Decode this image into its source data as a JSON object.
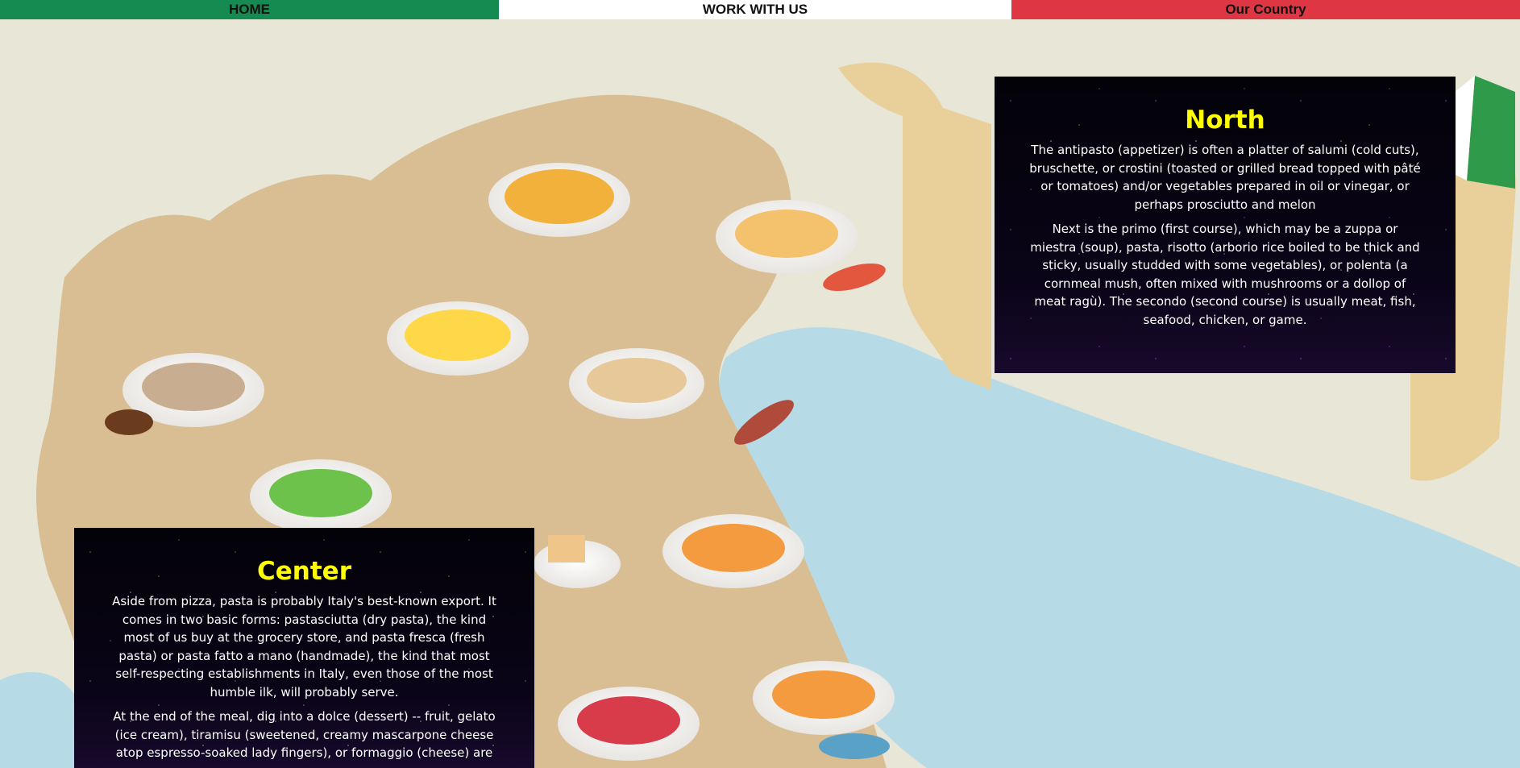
{
  "nav": {
    "home": "HOME",
    "work": "WORK WITH US",
    "country": "Our Country"
  },
  "colors": {
    "nav_home": "#168b51",
    "nav_work": "#ffffff",
    "nav_country": "#de3743",
    "panel_bg": "#05030d",
    "panel_title": "#ffff00",
    "sea": "#b7dbe6",
    "land": "#d9bd93"
  },
  "background": {
    "icon": "italy-food-map-illustration"
  },
  "north": {
    "title": "North",
    "paragraphs": [
      "The antipasto (appetizer) is often a platter of salumi (cold cuts), bruschette, or crostini (toasted or grilled bread topped with pâté or tomatoes) and/or vegetables prepared in oil or vinegar, or perhaps prosciutto and melon",
      "Next is the primo (first course), which may be a zuppa or miestra (soup), pasta, risotto (arborio rice boiled to be thick and sticky, usually studded with some vegetables), or polenta (a cornmeal mush, often mixed with mushrooms or a dollop of meat ragù). The secondo (second course) is usually meat, fish, seafood, chicken, or game."
    ]
  },
  "center": {
    "title": "Center",
    "paragraphs": [
      "Aside from pizza, pasta is probably Italy's best-known export. It comes in two basic forms: pastasciutta (dry pasta), the kind most of us buy at the grocery store, and pasta fresca (fresh pasta) or pasta fatto a mano (handmade), the kind that most self-respecting establishments in Italy, even those of the most humble ilk, will probably serve.",
      "At the end of the meal, dig into a dolce (dessert) -- fruit, gelato (ice cream), tiramisu (sweetened, creamy mascarpone cheese atop espresso-soaked lady fingers), or formaggio (cheese) are"
    ]
  }
}
